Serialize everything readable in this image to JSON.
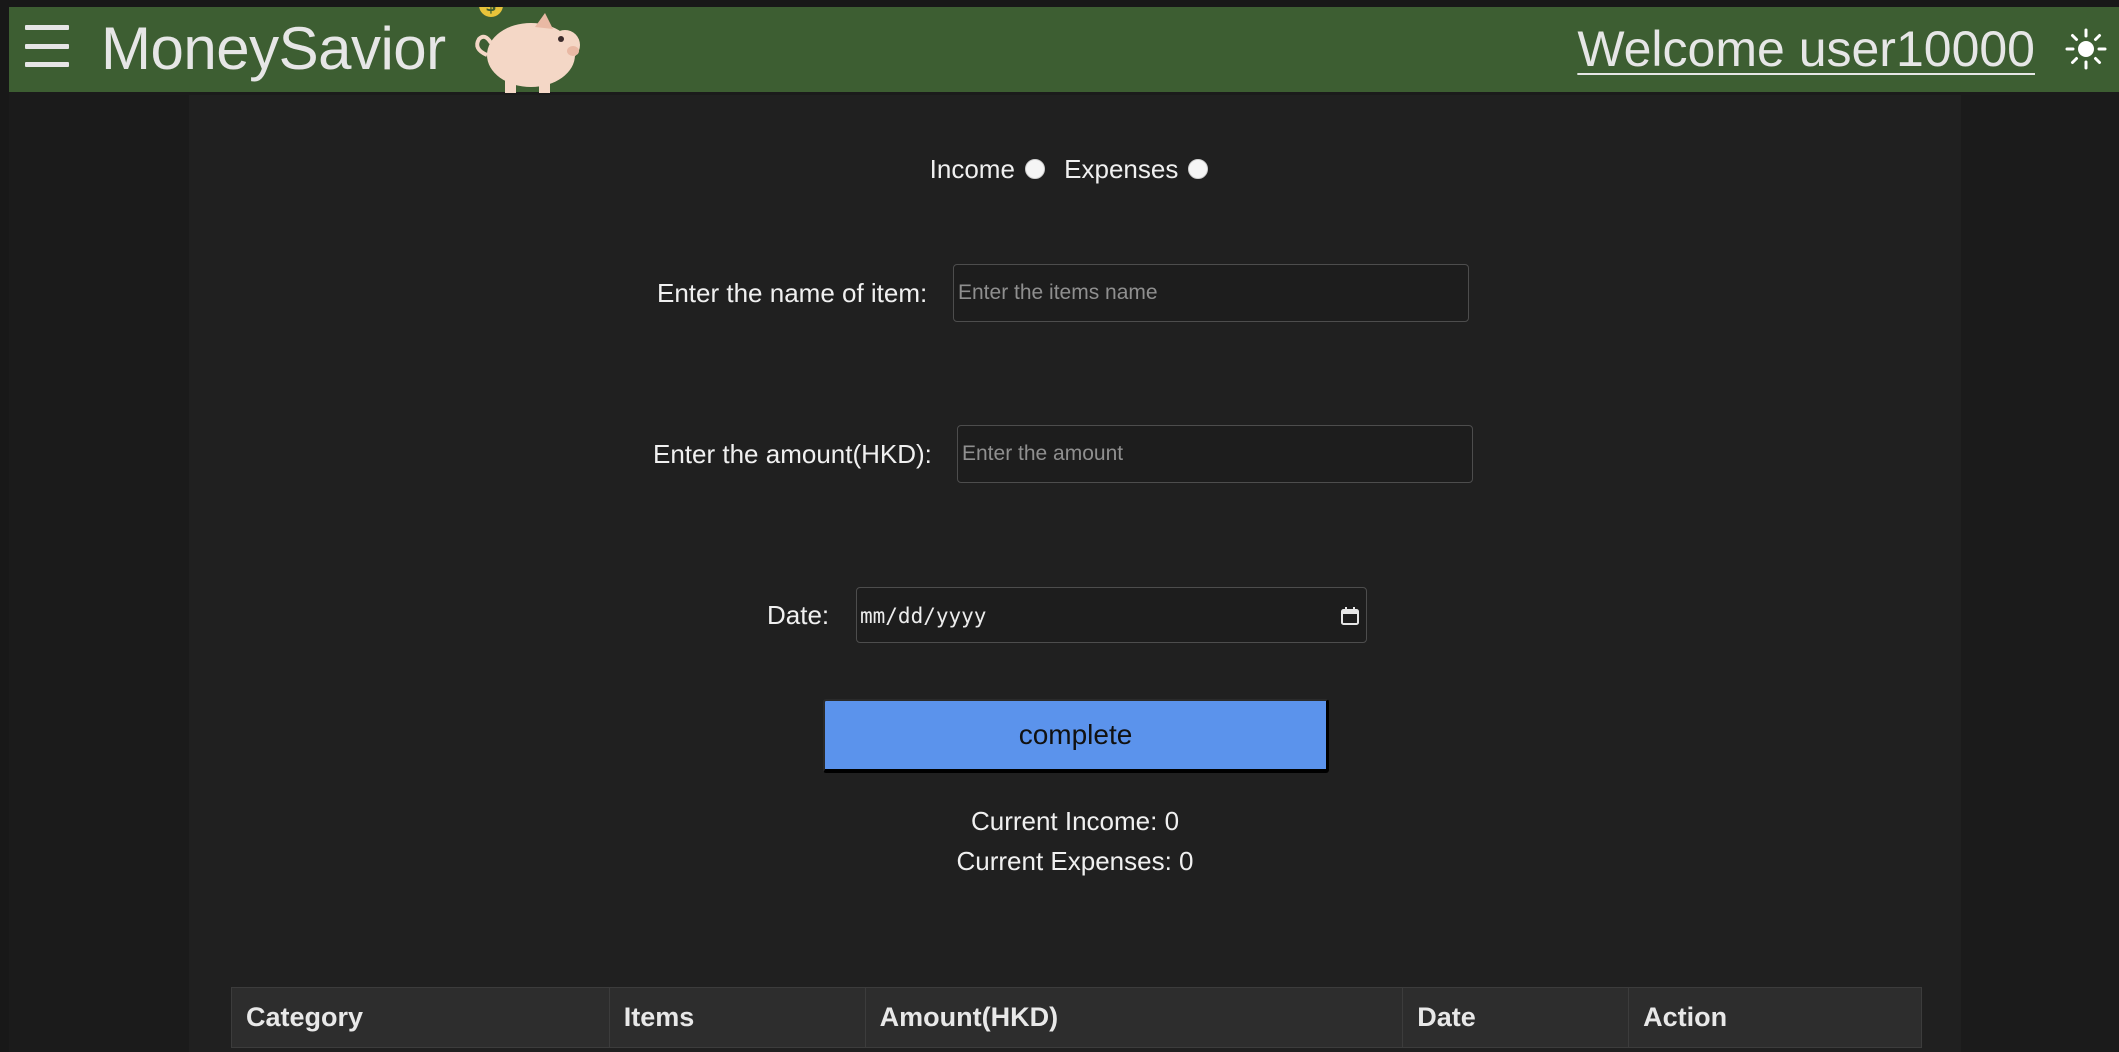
{
  "navbar": {
    "menu_icon": "hamburger-icon",
    "brand": "MoneySavior",
    "logo_icon": "piggy-bank-icon",
    "welcome": "Welcome user10000",
    "theme_icon": "sun-icon",
    "background_color": "#3d5e32"
  },
  "form": {
    "type_options": [
      {
        "label": "Income",
        "selected": false
      },
      {
        "label": "Expenses",
        "selected": false
      }
    ],
    "item_name": {
      "label": "Enter the name of item:",
      "placeholder": "Enter the items name",
      "value": ""
    },
    "amount": {
      "label": "Enter the amount(HKD):",
      "placeholder": "Enter the amount",
      "value": ""
    },
    "date": {
      "label": "Date:",
      "placeholder": "mm/dd/yyyy",
      "icon": "calendar-icon"
    },
    "submit_label": "complete",
    "submit_color": "#5b93ec"
  },
  "summary": {
    "income": "Current Income: 0",
    "expenses": "Current Expenses: 0"
  },
  "table": {
    "columns": [
      "Category",
      "Items",
      "Amount(HKD)",
      "Date",
      "Action"
    ],
    "rows": []
  }
}
